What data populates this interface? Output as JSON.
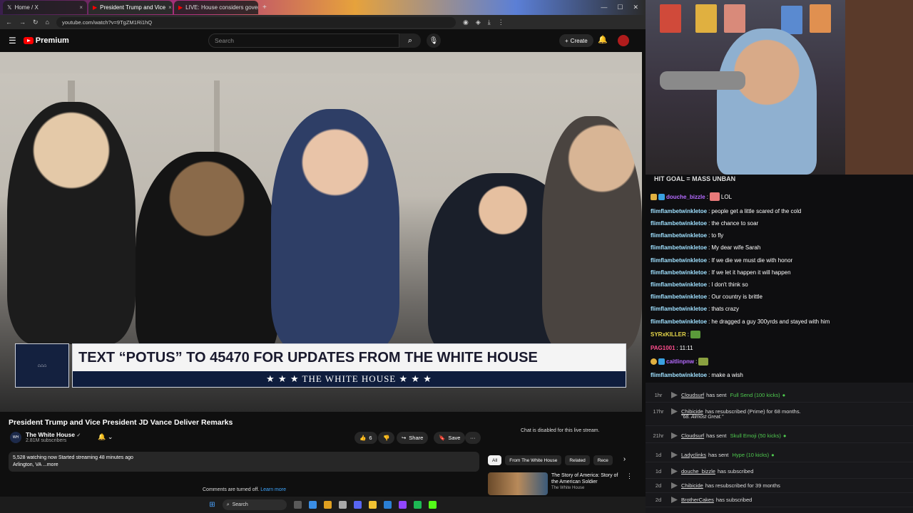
{
  "browser": {
    "tabs": [
      {
        "label": "Home / X",
        "active": false
      },
      {
        "label": "President Trump and Vice",
        "active": true
      },
      {
        "label": "LIVE: House considers governm",
        "active": false
      }
    ],
    "url": "youtube.com/watch?v=9TgZM1Ri1hQ"
  },
  "youtube": {
    "brand": "Premium",
    "search_placeholder": "Search",
    "create_label": "Create",
    "lower_third": {
      "headline": "TEXT “POTUS” TO 45470 FOR UPDATES FROM THE WHITE HOUSE",
      "banner": "★ ★ ★   THE WHITE HOUSE   ★ ★ ★"
    },
    "video_title": "President Trump and Vice President JD Vance Deliver Remarks",
    "channel_name": "The White House",
    "channel_verified": "✓",
    "channel_subs": "2.81M subscribers",
    "like_count": "6",
    "share_label": "Share",
    "save_label": "Save",
    "description_line1": "5,528 watching now  Started streaming 48 minutes ago",
    "description_line2": "Arlington, VA ...more",
    "comments_off": "Comments are turned off.",
    "learn_more": "Learn more",
    "chat_disabled": "Chat is disabled for this live stream.",
    "chips": [
      "All",
      "From The White House",
      "Related",
      "Rece"
    ],
    "recommended": {
      "title": "The Story of America: Story of the American Soldier",
      "channel": "The White House"
    },
    "taskbar_search": "Search"
  },
  "stream_chat": {
    "goal_text": "HIT GOAL = MASS UNBAN",
    "messages": [
      {
        "user": "douche_bizzle",
        "text": "LOL"
      },
      {
        "user": "flimflambetwinkletoe",
        "text": "people get a little scared of the cold"
      },
      {
        "user": "flimflambetwinkletoe",
        "text": "the chance to soar"
      },
      {
        "user": "flimflambetwinkletoe",
        "text": "to fly"
      },
      {
        "user": "flimflambetwinkletoe",
        "text": "My dear wife Sarah"
      },
      {
        "user": "flimflambetwinkletoe",
        "text": "If we die we must die with honor"
      },
      {
        "user": "flimflambetwinkletoe",
        "text": "If we let it happen it will happen"
      },
      {
        "user": "flimflambetwinkletoe",
        "text": "I don't think so"
      },
      {
        "user": "flimflambetwinkletoe",
        "text": "Our country is brittle"
      },
      {
        "user": "flimflambetwinkletoe",
        "text": "thats crazy"
      },
      {
        "user": "flimflambetwinkletoe",
        "text": "he dragged a guy 300yrds and stayed with him"
      },
      {
        "user": "SYRxKILLER",
        "text": ""
      },
      {
        "user": "PAG1001",
        "text": "11:11"
      },
      {
        "user": "caitlinpnw",
        "text": ""
      },
      {
        "user": "flimflambetwinkletoe",
        "text": "make a wish"
      }
    ]
  },
  "events": [
    {
      "time": "1hr",
      "user": "Cloudsurf",
      "action": "has sent",
      "item": "Full Send (100 kicks)"
    },
    {
      "time": "17hr",
      "user": "Chibicide",
      "action": "has resubscribed (Prime) for 68 months.",
      "item": "",
      "note": "\"68. Almost Great.\""
    },
    {
      "time": "21hr",
      "user": "Cloudsurf",
      "action": "has sent",
      "item": "Skull Emoji (50 kicks)"
    },
    {
      "time": "1d",
      "user": "Ladyclinks",
      "action": "has sent",
      "item": "Hype (10 kicks)"
    },
    {
      "time": "1d",
      "user": "douche_bizzle",
      "action": "has subscribed",
      "item": ""
    },
    {
      "time": "2d",
      "user": "Chibicide",
      "action": "has resubscribed for 39 months",
      "item": ""
    },
    {
      "time": "2d",
      "user": "BrotherCakes",
      "action": "has subscribed",
      "item": ""
    }
  ],
  "colors": {
    "yt_red": "#ff0000",
    "kick_green": "#53fc18",
    "chat_user": "#9fe0ff"
  }
}
